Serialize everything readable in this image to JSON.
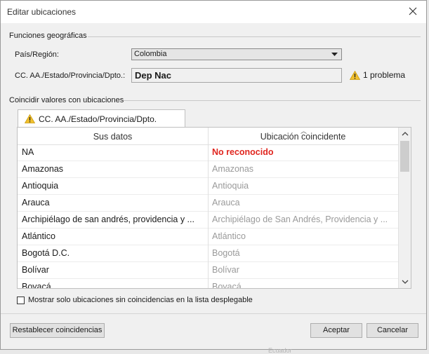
{
  "dialog": {
    "title": "Editar ubicaciones",
    "close_icon": "close-icon"
  },
  "geo_section": {
    "title": "Funciones geográficas",
    "country_label": "País/Región:",
    "country_value": "Colombia",
    "state_label": "CC. AA./Estado/Provincia/Dpto.:",
    "state_value": "Dep Nac",
    "problem_icon": "warning-icon",
    "problem_text": "1 problema"
  },
  "match_section": {
    "title": "Coincidir valores con ubicaciones",
    "tab_label": "CC. AA./Estado/Provincia/Dpto.",
    "col_data": "Sus datos",
    "col_match": "Ubicación coincidente",
    "rows": [
      {
        "data": "NA",
        "match": "No reconocido",
        "status": "unrecognized"
      },
      {
        "data": "Amazonas",
        "match": "Amazonas",
        "status": "matched"
      },
      {
        "data": "Antioquia",
        "match": "Antioquia",
        "status": "matched"
      },
      {
        "data": "Arauca",
        "match": "Arauca",
        "status": "matched"
      },
      {
        "data": "Archipiélago de san andrés, providencia y ...",
        "match": "Archipiélago de San Andrés, Providencia y ...",
        "status": "matched"
      },
      {
        "data": "Atlántico",
        "match": "Atlántico",
        "status": "matched"
      },
      {
        "data": "Bogotá D.C.",
        "match": "Bogotá",
        "status": "matched"
      },
      {
        "data": "Bolívar",
        "match": "Bolívar",
        "status": "matched"
      },
      {
        "data": "Boyacá",
        "match": "Boyacá",
        "status": "matched"
      }
    ],
    "checkbox_label": "Mostrar solo ubicaciones sin coincidencias en la lista desplegable",
    "checkbox_checked": false
  },
  "footer": {
    "reset_label": "Restablecer coincidencias",
    "ok_label": "Aceptar",
    "cancel_label": "Cancelar"
  },
  "background": {
    "partial_text": "Ecuador"
  },
  "colors": {
    "unrecognized": "#e0261f",
    "warning": "#f2c12e"
  }
}
